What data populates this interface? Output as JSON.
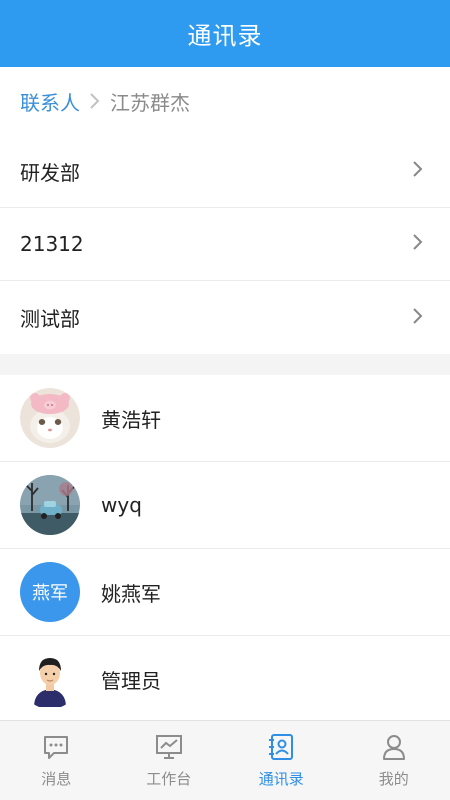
{
  "header": {
    "title": "通讯录"
  },
  "breadcrumb": {
    "root": "联系人",
    "current": "江苏群杰"
  },
  "departments": [
    {
      "name": "研发部"
    },
    {
      "name": "21312"
    },
    {
      "name": "测试部"
    }
  ],
  "contacts": [
    {
      "name": "黄浩轩",
      "avatar": "cat-photo"
    },
    {
      "name": "wyq",
      "avatar": "landscape-photo"
    },
    {
      "name": "姚燕军",
      "avatar_text": "燕军"
    },
    {
      "name": "管理员",
      "avatar": "cartoon-person"
    }
  ],
  "tabbar": {
    "items": [
      {
        "label": "消息",
        "icon": "message-icon"
      },
      {
        "label": "工作台",
        "icon": "workbench-icon"
      },
      {
        "label": "通讯录",
        "icon": "contacts-icon",
        "active": true
      },
      {
        "label": "我的",
        "icon": "profile-icon"
      }
    ]
  },
  "colors": {
    "accent": "#2f9bf0",
    "link": "#3a8fd8"
  }
}
